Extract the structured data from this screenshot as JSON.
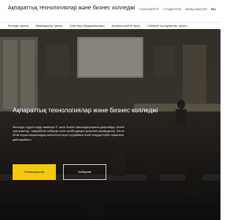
{
  "header": {
    "brand": "Ақпараттық технологиялар және бизнес колледжі",
    "top_nav": [
      "ТАЛАПКЕРГЕ",
      "СТУДЕНТКЕ",
      "ЖАҢАЛЫҚТАР",
      "RU"
    ]
  },
  "subnav": {
    "items": [
      "Колледж туралы",
      "Мамандықтар туралы",
      "Білім беру бағдарламалары",
      "Арнаулы кәсіптік оқыту",
      "Сабақтан тыс жұмыстар туралы"
    ]
  },
  "hero": {
    "title": "Ақпараттық технологиялар және бизнес колледжі",
    "description": "Колледж студенттерді заманауи IT және бизнес мамандықтарына даярлайды. Білікті оқытушылар, тәжірибелік сабақтар және кәсіби дамуға арналған мүмкіндіктер. Біз өз білім алушыларымыздың мансаптық өсуін қолдаймыз және оларды еңбек нарығына дайындаймыз.",
    "primary_button": "Мамандықтар",
    "secondary_button": "Хабарлас"
  },
  "colors": {
    "accent": "#f2c90f",
    "hero_overlay": "#3b3731"
  }
}
